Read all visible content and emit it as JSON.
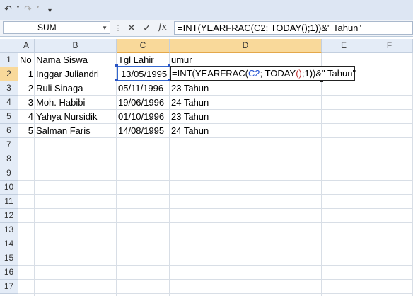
{
  "qat": {
    "undo_icon": "undo-icon",
    "redo_icon": "redo-icon",
    "customize_icon": "customize-icon"
  },
  "name_box": {
    "value": "SUM"
  },
  "formula_bar": {
    "cancel_icon": "cancel-icon",
    "enter_icon": "check-icon",
    "fx_label": "fx",
    "formula": "=INT(YEARFRAC(C2; TODAY();1))&\" Tahun\""
  },
  "columns": [
    "A",
    "B",
    "C",
    "D",
    "E",
    "F"
  ],
  "rows": [
    "1",
    "2",
    "3",
    "4",
    "5",
    "6",
    "7",
    "8",
    "9",
    "10",
    "11",
    "12",
    "13",
    "14",
    "15",
    "16",
    "17"
  ],
  "headers": {
    "no": "No",
    "nama": "Nama Siswa",
    "tgl": "Tgl Lahir",
    "umur": "umur"
  },
  "data": [
    {
      "no": "1",
      "nama": "Inggar Juliandri",
      "tgl": "13/05/1995",
      "umur": ""
    },
    {
      "no": "2",
      "nama": "Ruli Sinaga",
      "tgl": "05/11/1996",
      "umur": "23 Tahun"
    },
    {
      "no": "3",
      "nama": "Moh. Habibi",
      "tgl": "19/06/1996",
      "umur": "24 Tahun"
    },
    {
      "no": "4",
      "nama": "Yahya Nursidik",
      "tgl": "01/10/1996",
      "umur": "23 Tahun"
    },
    {
      "no": "5",
      "nama": "Salman Faris",
      "tgl": "14/08/1995",
      "umur": "24 Tahun"
    }
  ],
  "edit": {
    "p1": "=INT(YEARFRAC(",
    "ref": "C2",
    "p2": "; TODAY",
    "paren_open": "(",
    "paren_close": ")",
    "p3": ";1))&\" Tahun\""
  },
  "colors": {
    "selection": "#3366cc",
    "header_selected": "#f9d99a",
    "header": "#e4ecf7"
  }
}
